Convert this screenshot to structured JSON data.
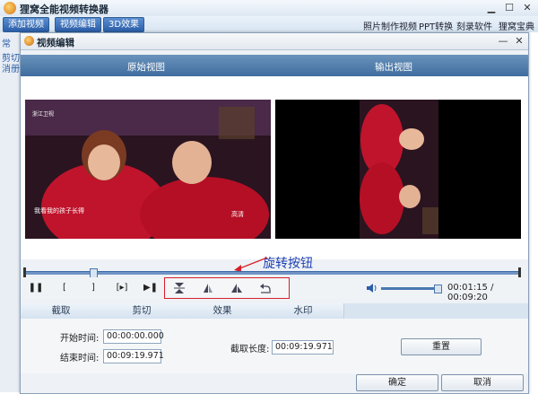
{
  "app": {
    "title": "狸窝全能视频转换器",
    "toolbar": [
      "添加视频",
      "视频编辑",
      "3D效果"
    ],
    "top_links": [
      "照片制作视频",
      "PPT转换",
      "刻录软件",
      "狸窝宝典"
    ],
    "sidebar_labels": [
      "常",
      "剪切",
      "消册"
    ]
  },
  "dialog": {
    "title": "视频编辑",
    "original_view_label": "原始视图",
    "output_view_label": "输出视图",
    "annotation": "旋转按钮",
    "time_display": "00:01:15 / 00:09:20",
    "playback_progress": 0.13,
    "volume_level": 0.9,
    "tabs": [
      "截取",
      "剪切",
      "效果",
      "水印"
    ],
    "active_tab": 0,
    "start_label": "开始时间:",
    "start_value": "00:00:00.000",
    "end_label": "结束时间:",
    "end_value": "00:09:19.971",
    "duration_label": "截取长度:",
    "duration_value": "00:09:19.971",
    "reset_button": "重置",
    "ok_button": "确定",
    "cancel_button": "取消",
    "video_caption": "我看我的孩子长得",
    "video_channel": "浙江卫视",
    "video_logo": "高清",
    "annotation_color": "#1e3fb0",
    "highlight_color": "#d8202a"
  }
}
